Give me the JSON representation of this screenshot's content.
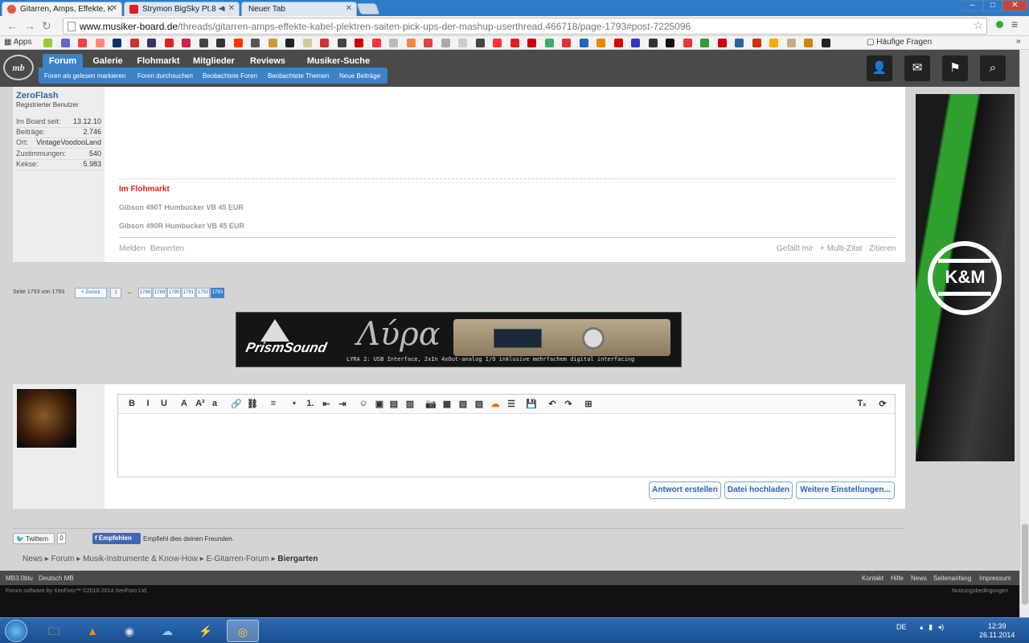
{
  "browser": {
    "tabs": [
      {
        "title": "Gitarren, Amps, Effekte, K",
        "icon_color": "#e8564a"
      },
      {
        "title": "Strymon BigSky Pt.8 - ‹",
        "icon_color": "#d22"
      },
      {
        "title": "Neuer Tab",
        "icon_color": ""
      }
    ],
    "url_host": "www.musiker-board.de",
    "url_path": "/threads/gitarren-amps-effekte-kabel-plektren-saiten-pick-ups-der-mashup-userthread.466718/page-1793#post-7225096",
    "bookmarks_apps_label": "Apps",
    "bookmarks_faq_label": "Häufige Fragen",
    "window_controls": [
      "–",
      "□",
      "✕"
    ]
  },
  "forum": {
    "logo_text": "mb",
    "nav_tabs": [
      "Forum",
      "Galerie",
      "Flohmarkt",
      "Mitglieder",
      "Reviews",
      "Musiker-Suche"
    ],
    "sub_nav": [
      "Foren als gelesen markieren",
      "Foren durchsuchen",
      "Beobachtete Foren",
      "Beobachtete Themen",
      "Neue Beiträge"
    ],
    "header_icons": [
      "user-icon",
      "mail-icon",
      "flag-icon",
      "search-icon"
    ]
  },
  "post": {
    "author": "ZeroFlash",
    "user_title": "Registrierter Benutzer",
    "stats": [
      {
        "label": "Im Board seit:",
        "value": "13.12.10"
      },
      {
        "label": "Beiträge:",
        "value": "2.746"
      },
      {
        "label": "Ort:",
        "value": "VintageVoodooLand"
      },
      {
        "label": "Zustimmungen:",
        "value": "540"
      },
      {
        "label": "Kekse:",
        "value": "5.983"
      }
    ],
    "flohmarkt_heading": "Im Flohmarkt",
    "flohmarkt_items": [
      "Gibson 490T Humbucker VB 45 EUR",
      "Gibson 490R Humbucker VB 45 EUR"
    ],
    "actions_left": [
      "Melden",
      "Bewerten"
    ],
    "actions_right": [
      "Gefällt mir",
      "+ Multi-Zitat",
      "Zitieren"
    ]
  },
  "pager": {
    "label": "Seite 1793 von 1793",
    "back": "< Zurück",
    "first": "1",
    "arrow": "←",
    "pages": [
      "1788",
      "1789",
      "1790",
      "1791",
      "1792",
      "1793"
    ],
    "current": "1793"
  },
  "banner": {
    "brand": "PrismSound",
    "product": "Λύρα",
    "text": "LYRA 2: USB Interface, 2xIn 4xOut-analog I/O inklusive mehrfachem digital interfacing"
  },
  "reply": {
    "toolbar": [
      "B",
      "I",
      "U",
      "A",
      "A²",
      "a",
      "🔗",
      "⛓",
      "≡",
      "•",
      "1.",
      "⇤",
      "⇥",
      "☺",
      "▣",
      "▤",
      "▥",
      "📷",
      "▦",
      "▧",
      "▨",
      "☁",
      "☰",
      "💾",
      "↶",
      "↷",
      "⊞",
      "Tₓ",
      "⟳"
    ],
    "buttons": [
      "Antwort erstellen",
      "Datei hochladen",
      "Weitere Einstellungen..."
    ]
  },
  "side_ad": {
    "brand": "K&M"
  },
  "social": {
    "twitter_label": "Twittern",
    "twitter_count": "0",
    "facebook_label": "Empfehlen",
    "facebook_text": "Empfiehl dies deinen Freunden."
  },
  "breadcrumbs": [
    "News",
    "Forum",
    "Musik-Instrumente & Know-How",
    "E-Gitarren-Forum",
    "Biergarten"
  ],
  "footer": {
    "left": [
      "MB3.0blu",
      "Deutsch MB"
    ],
    "right": [
      "Kontakt",
      "Hilfe",
      "News",
      "Seitenanfang",
      "Impressum"
    ],
    "copyright": "Forum software by XenForo™ ©2010-2014 XenForo Ltd.",
    "terms": "Nutzungsbedingungen"
  },
  "taskbar": {
    "apps": [
      "explorer-icon",
      "vlc-icon",
      "steam-icon",
      "cloud-icon",
      "winamp-icon",
      "chrome-icon"
    ],
    "lang": "DE",
    "time": "12:39",
    "date": "26.11.2014"
  }
}
